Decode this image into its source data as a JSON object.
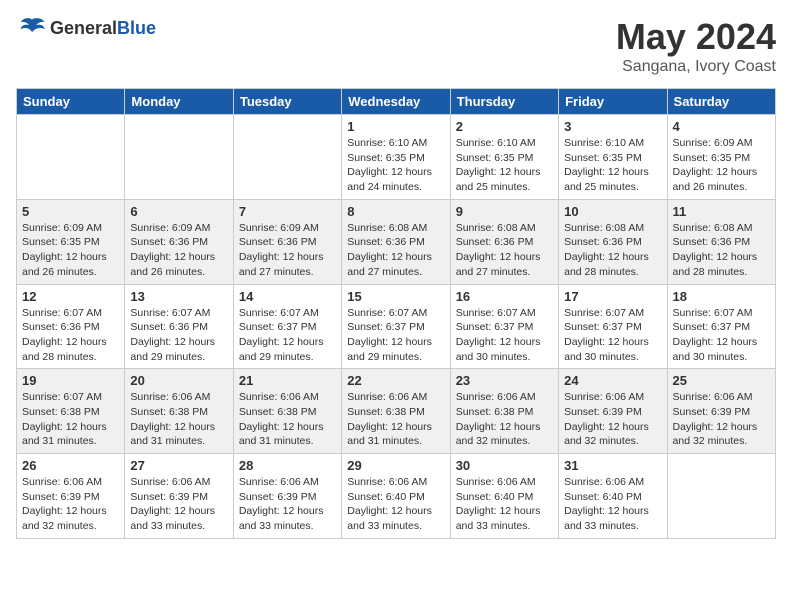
{
  "header": {
    "logo_general": "General",
    "logo_blue": "Blue",
    "month_title": "May 2024",
    "location": "Sangana, Ivory Coast"
  },
  "days_of_week": [
    "Sunday",
    "Monday",
    "Tuesday",
    "Wednesday",
    "Thursday",
    "Friday",
    "Saturday"
  ],
  "weeks": [
    [
      {
        "day": "",
        "info": ""
      },
      {
        "day": "",
        "info": ""
      },
      {
        "day": "",
        "info": ""
      },
      {
        "day": "1",
        "info": "Sunrise: 6:10 AM\nSunset: 6:35 PM\nDaylight: 12 hours\nand 24 minutes."
      },
      {
        "day": "2",
        "info": "Sunrise: 6:10 AM\nSunset: 6:35 PM\nDaylight: 12 hours\nand 25 minutes."
      },
      {
        "day": "3",
        "info": "Sunrise: 6:10 AM\nSunset: 6:35 PM\nDaylight: 12 hours\nand 25 minutes."
      },
      {
        "day": "4",
        "info": "Sunrise: 6:09 AM\nSunset: 6:35 PM\nDaylight: 12 hours\nand 26 minutes."
      }
    ],
    [
      {
        "day": "5",
        "info": "Sunrise: 6:09 AM\nSunset: 6:35 PM\nDaylight: 12 hours\nand 26 minutes."
      },
      {
        "day": "6",
        "info": "Sunrise: 6:09 AM\nSunset: 6:36 PM\nDaylight: 12 hours\nand 26 minutes."
      },
      {
        "day": "7",
        "info": "Sunrise: 6:09 AM\nSunset: 6:36 PM\nDaylight: 12 hours\nand 27 minutes."
      },
      {
        "day": "8",
        "info": "Sunrise: 6:08 AM\nSunset: 6:36 PM\nDaylight: 12 hours\nand 27 minutes."
      },
      {
        "day": "9",
        "info": "Sunrise: 6:08 AM\nSunset: 6:36 PM\nDaylight: 12 hours\nand 27 minutes."
      },
      {
        "day": "10",
        "info": "Sunrise: 6:08 AM\nSunset: 6:36 PM\nDaylight: 12 hours\nand 28 minutes."
      },
      {
        "day": "11",
        "info": "Sunrise: 6:08 AM\nSunset: 6:36 PM\nDaylight: 12 hours\nand 28 minutes."
      }
    ],
    [
      {
        "day": "12",
        "info": "Sunrise: 6:07 AM\nSunset: 6:36 PM\nDaylight: 12 hours\nand 28 minutes."
      },
      {
        "day": "13",
        "info": "Sunrise: 6:07 AM\nSunset: 6:36 PM\nDaylight: 12 hours\nand 29 minutes."
      },
      {
        "day": "14",
        "info": "Sunrise: 6:07 AM\nSunset: 6:37 PM\nDaylight: 12 hours\nand 29 minutes."
      },
      {
        "day": "15",
        "info": "Sunrise: 6:07 AM\nSunset: 6:37 PM\nDaylight: 12 hours\nand 29 minutes."
      },
      {
        "day": "16",
        "info": "Sunrise: 6:07 AM\nSunset: 6:37 PM\nDaylight: 12 hours\nand 30 minutes."
      },
      {
        "day": "17",
        "info": "Sunrise: 6:07 AM\nSunset: 6:37 PM\nDaylight: 12 hours\nand 30 minutes."
      },
      {
        "day": "18",
        "info": "Sunrise: 6:07 AM\nSunset: 6:37 PM\nDaylight: 12 hours\nand 30 minutes."
      }
    ],
    [
      {
        "day": "19",
        "info": "Sunrise: 6:07 AM\nSunset: 6:38 PM\nDaylight: 12 hours\nand 31 minutes."
      },
      {
        "day": "20",
        "info": "Sunrise: 6:06 AM\nSunset: 6:38 PM\nDaylight: 12 hours\nand 31 minutes."
      },
      {
        "day": "21",
        "info": "Sunrise: 6:06 AM\nSunset: 6:38 PM\nDaylight: 12 hours\nand 31 minutes."
      },
      {
        "day": "22",
        "info": "Sunrise: 6:06 AM\nSunset: 6:38 PM\nDaylight: 12 hours\nand 31 minutes."
      },
      {
        "day": "23",
        "info": "Sunrise: 6:06 AM\nSunset: 6:38 PM\nDaylight: 12 hours\nand 32 minutes."
      },
      {
        "day": "24",
        "info": "Sunrise: 6:06 AM\nSunset: 6:39 PM\nDaylight: 12 hours\nand 32 minutes."
      },
      {
        "day": "25",
        "info": "Sunrise: 6:06 AM\nSunset: 6:39 PM\nDaylight: 12 hours\nand 32 minutes."
      }
    ],
    [
      {
        "day": "26",
        "info": "Sunrise: 6:06 AM\nSunset: 6:39 PM\nDaylight: 12 hours\nand 32 minutes."
      },
      {
        "day": "27",
        "info": "Sunrise: 6:06 AM\nSunset: 6:39 PM\nDaylight: 12 hours\nand 33 minutes."
      },
      {
        "day": "28",
        "info": "Sunrise: 6:06 AM\nSunset: 6:39 PM\nDaylight: 12 hours\nand 33 minutes."
      },
      {
        "day": "29",
        "info": "Sunrise: 6:06 AM\nSunset: 6:40 PM\nDaylight: 12 hours\nand 33 minutes."
      },
      {
        "day": "30",
        "info": "Sunrise: 6:06 AM\nSunset: 6:40 PM\nDaylight: 12 hours\nand 33 minutes."
      },
      {
        "day": "31",
        "info": "Sunrise: 6:06 AM\nSunset: 6:40 PM\nDaylight: 12 hours\nand 33 minutes."
      },
      {
        "day": "",
        "info": ""
      }
    ]
  ]
}
